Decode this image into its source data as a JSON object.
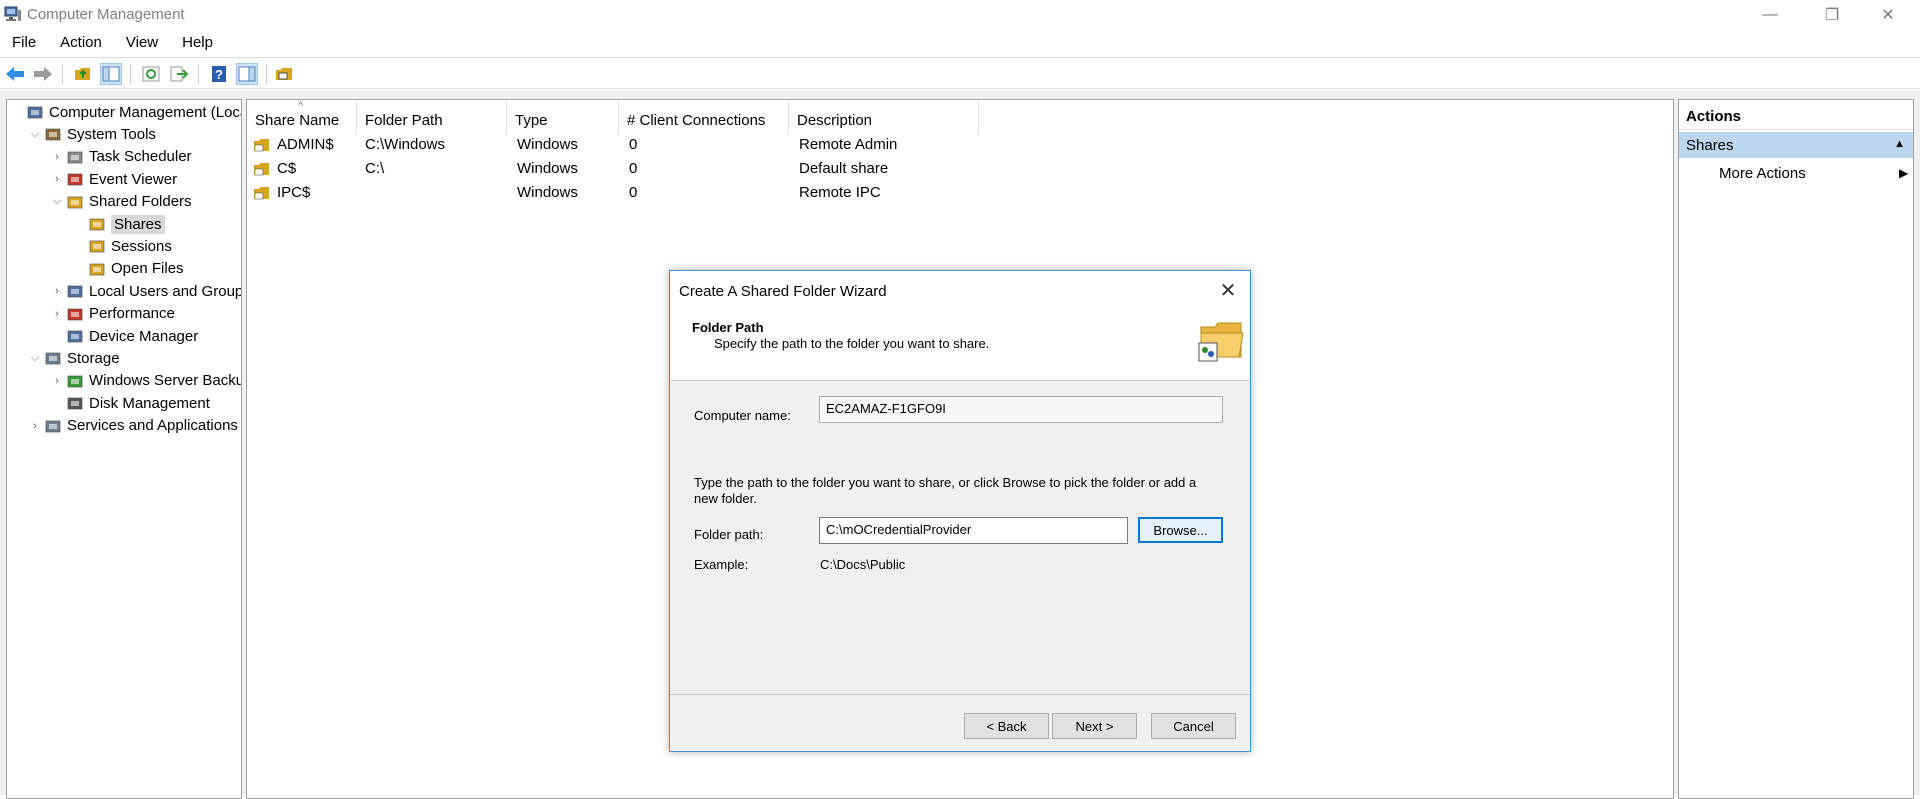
{
  "window": {
    "title": "Computer Management",
    "minimize": "—",
    "restore": "❐",
    "close": "✕"
  },
  "menu": [
    "File",
    "Action",
    "View",
    "Help"
  ],
  "toolbar": {
    "buttons": [
      {
        "name": "back-arrow-icon",
        "color": "#2f8fdf"
      },
      {
        "name": "forward-arrow-icon",
        "color": "#9a9a9a"
      },
      {
        "name": "up-folder-icon",
        "color": "#d9a520"
      },
      {
        "name": "show-hide-tree-icon",
        "color": "#4f7fbf"
      },
      {
        "name": "refresh-icon",
        "color": "#3a9a3a"
      },
      {
        "name": "export-list-icon",
        "color": "#3a9a3a"
      },
      {
        "name": "help-icon",
        "color": "#2a5db0"
      },
      {
        "name": "show-hide-action-pane-icon",
        "color": "#4f7fbf"
      },
      {
        "name": "new-share-icon",
        "color": "#d9a520"
      }
    ]
  },
  "tree": [
    {
      "label": "Computer Management (Local",
      "level": 0,
      "expander": "",
      "icon": "computer-icon",
      "color": "#4f6fa0"
    },
    {
      "label": "System Tools",
      "level": 1,
      "expander": "⌵",
      "icon": "tools-icon",
      "color": "#8a6a3a"
    },
    {
      "label": "Task Scheduler",
      "level": 2,
      "expander": "›",
      "icon": "clock-icon",
      "color": "#8a8a8a"
    },
    {
      "label": "Event Viewer",
      "level": 2,
      "expander": "›",
      "icon": "event-viewer-icon",
      "color": "#c0392b"
    },
    {
      "label": "Shared Folders",
      "level": 2,
      "expander": "⌵",
      "icon": "shared-folder-icon",
      "color": "#d9a520"
    },
    {
      "label": "Shares",
      "level": 3,
      "expander": "",
      "icon": "shares-icon",
      "color": "#d9a520",
      "selected": true
    },
    {
      "label": "Sessions",
      "level": 3,
      "expander": "",
      "icon": "sessions-icon",
      "color": "#d9a520"
    },
    {
      "label": "Open Files",
      "level": 3,
      "expander": "",
      "icon": "open-files-icon",
      "color": "#d9a520"
    },
    {
      "label": "Local Users and Groups",
      "level": 2,
      "expander": "›",
      "icon": "users-icon",
      "color": "#4f6fa0"
    },
    {
      "label": "Performance",
      "level": 2,
      "expander": "›",
      "icon": "performance-icon",
      "color": "#c0392b"
    },
    {
      "label": "Device Manager",
      "level": 2,
      "expander": "",
      "icon": "device-manager-icon",
      "color": "#4f6fa0"
    },
    {
      "label": "Storage",
      "level": 1,
      "expander": "⌵",
      "icon": "storage-icon",
      "color": "#6f7f8f"
    },
    {
      "label": "Windows Server Backup",
      "level": 2,
      "expander": "›",
      "icon": "backup-icon",
      "color": "#3a9a3a"
    },
    {
      "label": "Disk Management",
      "level": 2,
      "expander": "",
      "icon": "disk-icon",
      "color": "#555555"
    },
    {
      "label": "Services and Applications",
      "level": 1,
      "expander": "›",
      "icon": "services-icon",
      "color": "#6f7f8f"
    }
  ],
  "list": {
    "sort_glyph": "^",
    "columns": [
      "Share Name",
      "Folder Path",
      "Type",
      "# Client Connections",
      "Description"
    ],
    "rows": [
      {
        "name": "ADMIN$",
        "path": "C:\\Windows",
        "type": "Windows",
        "connections": "0",
        "description": "Remote Admin"
      },
      {
        "name": "C$",
        "path": "C:\\",
        "type": "Windows",
        "connections": "0",
        "description": "Default share"
      },
      {
        "name": "IPC$",
        "path": "",
        "type": "Windows",
        "connections": "0",
        "description": "Remote IPC"
      }
    ]
  },
  "actions": {
    "title": "Actions",
    "group": "Shares",
    "group_caret": "▲",
    "item": "More Actions",
    "item_arrow": "▶"
  },
  "dialog": {
    "title": "Create A Shared Folder Wizard",
    "close": "✕",
    "header_title": "Folder Path",
    "header_subtitle": "Specify the path to the folder you want to share.",
    "computer_name_label": "Computer name:",
    "computer_name_value": "EC2AMAZ-F1GFO9I",
    "instructions": "Type the path to the folder you want to share, or click Browse to pick the folder or add a new folder.",
    "folder_path_label": "Folder path:",
    "folder_path_value": "C:\\mOCredentialProvider",
    "browse_label": "Browse...",
    "example_label": "Example:",
    "example_value": "C:\\Docs\\Public",
    "back_label": "< Back",
    "next_label": "Next >",
    "cancel_label": "Cancel"
  }
}
